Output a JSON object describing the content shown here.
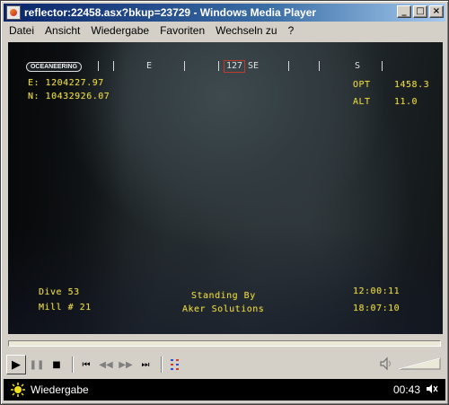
{
  "window": {
    "title": "reflector:22458.asx?bkup=23729 - Windows Media Player"
  },
  "caption_buttons": {
    "minimize": "_",
    "maximize": "□",
    "close": "×"
  },
  "menu": {
    "items": [
      "Datei",
      "Ansicht",
      "Wiedergabe",
      "Favoriten",
      "Wechseln zu",
      "?"
    ]
  },
  "video": {
    "logo": "OCEANEERING",
    "compass": {
      "letters": [
        "E",
        "SE",
        "S"
      ],
      "heading": "127"
    },
    "easting": "E: 1204227.97",
    "northing": "N: 10432926.07",
    "opt_label": "OPT",
    "opt_value": "1458.3",
    "alt_label": "ALT",
    "alt_value": "11.0",
    "dive": "Dive 53",
    "mill": "Mill # 21",
    "caption_line1": "Standing By",
    "caption_line2": "Aker Solutions",
    "time": "12:00:11",
    "date": "18:07:10"
  },
  "seek": {
    "progress": 0
  },
  "transport": {
    "play": "▶",
    "pause": "❚❚",
    "stop": "■",
    "prev": "⏮",
    "rewind": "◀◀",
    "fast_forward": "▶▶",
    "next": "⏭"
  },
  "status": {
    "text": "Wiedergabe",
    "time": "00:43",
    "speaker": "🔈"
  },
  "colors": {
    "osd_text": "#e6d84a",
    "heading_box": "#c0392b",
    "title_bar": "#0a246a"
  }
}
